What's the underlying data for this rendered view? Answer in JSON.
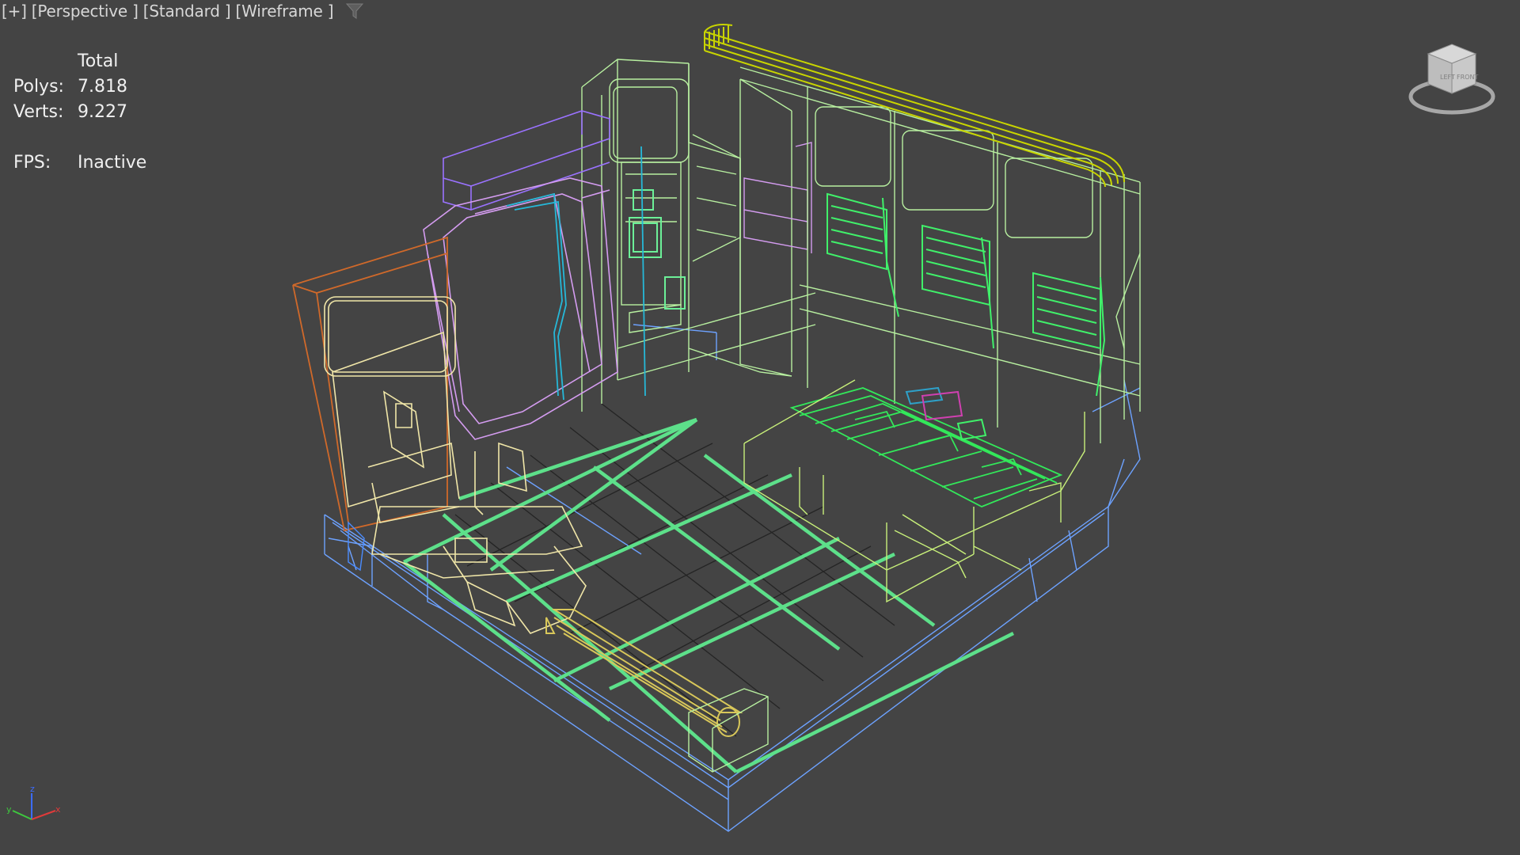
{
  "viewport": {
    "labels": {
      "plus": "[+]",
      "view": "[Perspective ]",
      "shading": "[Standard ]",
      "display_mode": "[Wireframe ]"
    },
    "filter_icon": "viewport-filter-icon"
  },
  "stats": {
    "header": "Total",
    "polys_label": "Polys:",
    "polys_value": "7.818",
    "verts_label": "Verts:",
    "verts_value": "9.227",
    "fps_label": "FPS:",
    "fps_value": "Inactive"
  },
  "viewcube": {
    "face_left": "LEFT",
    "face_front": "FRONT"
  },
  "axis": {
    "x": "x",
    "y": "y",
    "z": "z"
  },
  "colors": {
    "background": "#444444",
    "grid": "#222222",
    "floor_green": "#5de08a",
    "bench_green": "#33e85a",
    "wall_green": "#b8f0a0",
    "pipe_yellow": "#c8d400",
    "door_purple": "#9a72ff",
    "door_pink": "#d49cf0",
    "panel_orange": "#d0692a",
    "cream": "#f0e6a8",
    "base_blue": "#6da2ff"
  }
}
